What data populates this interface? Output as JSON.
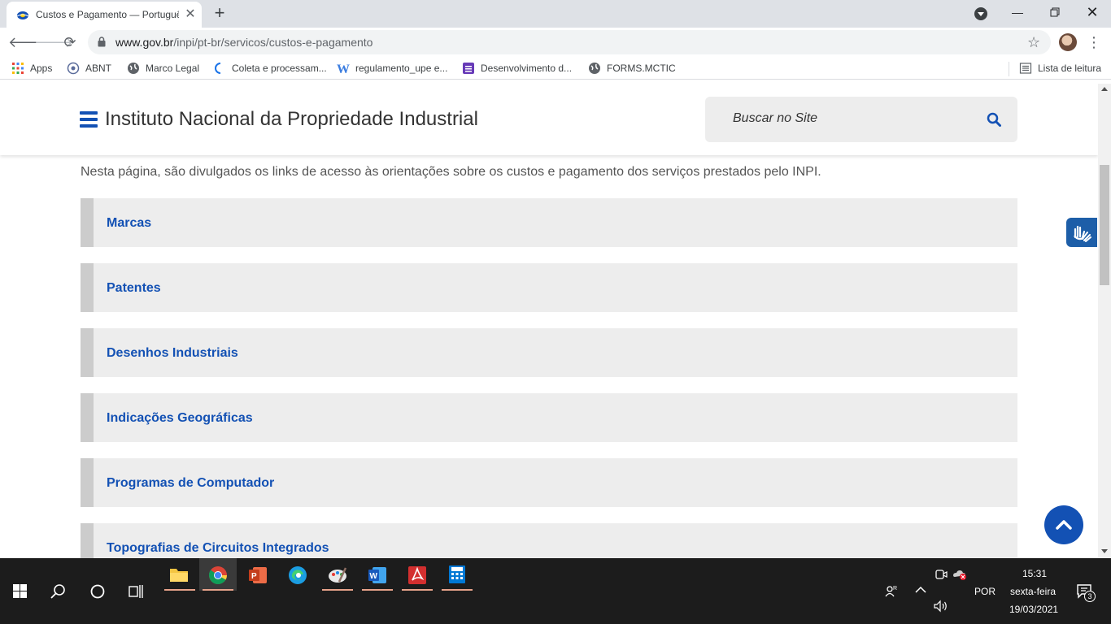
{
  "browser": {
    "tab_title": "Custos e Pagamento — Português",
    "url_domain": "www.gov.br",
    "url_path": "/inpi/pt-br/servicos/custos-e-pagamento"
  },
  "bookmarks": [
    {
      "label": "Apps",
      "icon": "apps-grid-icon"
    },
    {
      "label": "ABNT",
      "icon": "abnt-icon"
    },
    {
      "label": "Marco Legal",
      "icon": "globe-icon"
    },
    {
      "label": "Coleta e processam...",
      "icon": "coleta-icon"
    },
    {
      "label": "regulamento_upe e...",
      "icon": "w-icon"
    },
    {
      "label": "Desenvolvimento d...",
      "icon": "forms-icon"
    },
    {
      "label": "FORMS.MCTIC",
      "icon": "globe-icon"
    }
  ],
  "reading_list": "Lista de leitura",
  "site": {
    "title": "Instituto Nacional da Propriedade Industrial",
    "search_placeholder": "Buscar no Site",
    "intro": "Nesta página, são divulgados os links de acesso às orientações sobre os custos e pagamento dos serviços prestados pelo INPI.",
    "items": [
      "Marcas",
      "Patentes",
      "Desenhos Industriais",
      "Indicações Geográficas",
      "Programas de Computador",
      "Topografias de Circuitos Integrados"
    ]
  },
  "taskbar": {
    "language": "POR",
    "time": "15:31",
    "day": "sexta-feira",
    "date": "19/03/2021",
    "notifications": "3"
  },
  "colors": {
    "link_blue": "#1351b4",
    "item_bg": "#ededed",
    "item_border": "#cccccc"
  }
}
